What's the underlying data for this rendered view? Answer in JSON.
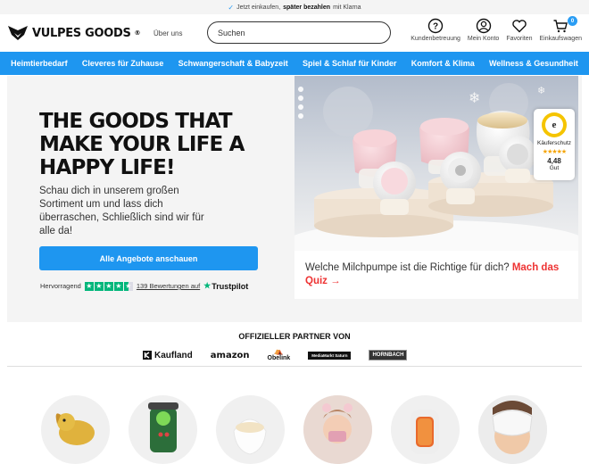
{
  "topbar": {
    "check_icon": "check-icon",
    "pre": "Jetzt einkaufen,",
    "bold": "später bezahlen",
    "post": "mit Klarna"
  },
  "header": {
    "logo_text": "VULPES GOODS",
    "about": "Über uns",
    "search_placeholder": "Suchen",
    "icons": [
      {
        "name": "help-icon",
        "label": "Kundenbetreuung"
      },
      {
        "name": "user-icon",
        "label": "Mein Konto"
      },
      {
        "name": "heart-icon",
        "label": "Favoriten"
      },
      {
        "name": "cart-icon",
        "label": "Einkaufswagen",
        "badge": "0"
      }
    ]
  },
  "nav": {
    "items": [
      "Heimtierbedarf",
      "Cleveres für Zuhause",
      "Schwangerschaft & Babyzeit",
      "Spiel & Schlaf für Kinder",
      "Komfort & Klima",
      "Wellness & Gesundheit"
    ]
  },
  "hero": {
    "headline": "THE GOODS THAT MAKE YOUR LIFE A HAPPY LIFE!",
    "lead": "Schau dich in unserem großen Sortiment um und lass dich überraschen, Schließlich sind wir für alle da!",
    "cta": "Alle Angebote anschauen",
    "trustpilot": {
      "rating_word": "Hervorragend",
      "reviews": "139 Bewertungen auf",
      "brand": "Trustpilot",
      "stars": 4.5
    },
    "caption_pre": "Welche Milchpumpe ist die Richtige für dich?",
    "caption_link": "Mach das Quiz →"
  },
  "trusted": {
    "label": "Käuferschutz",
    "score": "4,48",
    "grade": "Gut",
    "seal_letter": "e"
  },
  "partners": {
    "title": "OFFIZIELLER PARTNER VON",
    "logos": [
      "Kaufland",
      "amazon",
      "Obelink",
      "MediaMarkt Saturn",
      "HORNBACH"
    ]
  },
  "colors": {
    "accent": "#1e96f0",
    "quiz": "#e33333",
    "trustpilot": "#00b67a"
  }
}
